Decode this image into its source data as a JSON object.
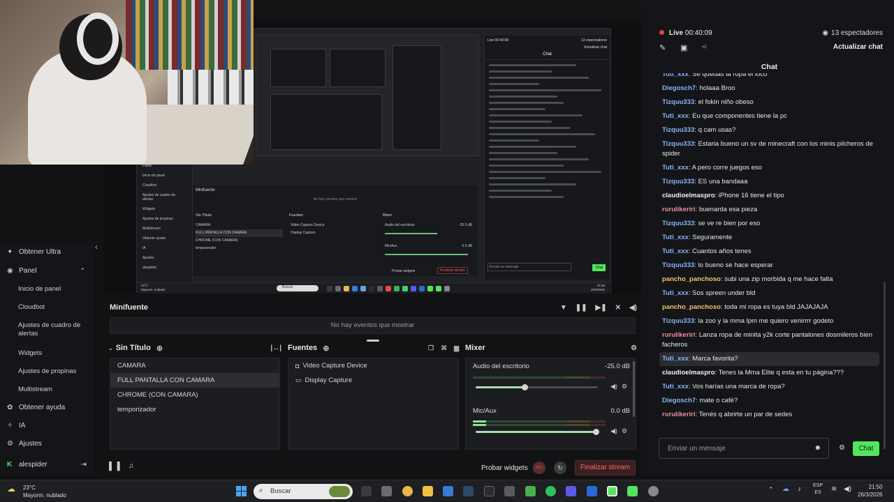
{
  "window": {
    "controls": [
      "—",
      "☐",
      "✕"
    ]
  },
  "camera": {},
  "preview": {
    "mini": {
      "sidebar": [
        "Panel",
        "Inicio de panel",
        "Cloudbot",
        "Ajustes de cuadro de alertas",
        "Widgets",
        "Ajustes de propinas",
        "Multistream",
        "Obtener ayuda",
        "IA",
        "Ajustes",
        "alespider"
      ],
      "minifeed": "Minifuente",
      "no_events": "No hay eventos que mostrar",
      "scenes_title": "Sin Título",
      "scenes": [
        "CAMARA",
        "FULL PANTALLA CON CAMARA",
        "CHROME (CON CAMARA)",
        "temporizador"
      ],
      "sources_title": "Fuentes",
      "sources": [
        "Video Capture Device",
        "Display Capture"
      ],
      "mixer_title": "Mixer",
      "mixer": [
        {
          "name": "Audio del escritorio",
          "db": "-25.0 dB"
        },
        {
          "name": "Mic/Aux",
          "db": "0.0 dB"
        }
      ],
      "test_widgets": "Probar widgets",
      "end_stream": "Finalizar stream",
      "chat_title": "Chat",
      "live": "Live 00:40:08",
      "viewers": "13 espectadores",
      "update_chat": "Actualizar chat",
      "chat_placeholder": "Enviar un mensaje",
      "chat_button": "Chat",
      "weather_temp": "23°C",
      "weather_desc": "Mayorm. nublado",
      "search": "Buscar",
      "time": "21:50",
      "date": "26/3/2026"
    }
  },
  "sidebar": {
    "items": [
      {
        "icon": "gem-icon",
        "label": "Obtener Ultra"
      },
      {
        "icon": "panel-icon",
        "label": "Panel"
      }
    ],
    "sub": [
      "Inicio de panel",
      "Cloudbot",
      "Ajustes de cuadro de alertas",
      "Widgets",
      "Ajustes de propinas",
      "Multistream"
    ],
    "bottom": [
      {
        "icon": "help-icon",
        "label": "Obtener ayuda"
      },
      {
        "icon": "ai-icon",
        "label": "IA"
      },
      {
        "icon": "gear-icon",
        "label": "Ajustes"
      }
    ],
    "user": "alespider"
  },
  "minifeed": {
    "title": "Minifuente",
    "empty": "No hay eventos que mostrar"
  },
  "scenes": {
    "title": "Sin Título",
    "items": [
      "CAMARA",
      "FULL PANTALLA CON CAMARA",
      "CHROME (CON CAMARA)",
      "temporizador"
    ],
    "selected": 1
  },
  "sources": {
    "title": "Fuentes",
    "items": [
      {
        "icon": "camera-icon",
        "label": "Video Capture Device"
      },
      {
        "icon": "monitor-icon",
        "label": "Display Capture"
      }
    ]
  },
  "mixer": {
    "title": "Mixer",
    "channels": [
      {
        "name": "Audio del escritorio",
        "db": "-25.0 dB",
        "volume": 0.4,
        "level": 0.0
      },
      {
        "name": "Mic/Aux",
        "db": "0.0 dB",
        "volume": 0.98,
        "level": 0.1
      }
    ]
  },
  "bottom_bar": {
    "test_widgets": "Probar widgets",
    "end_stream": "Finalizar stream",
    "rec": "REC"
  },
  "stream": {
    "live_label": "Live",
    "live_time": "00:40:09",
    "viewers": "13 espectadores",
    "update_chat": "Actualizar chat",
    "live_color": "#e0443c"
  },
  "chat": {
    "title": "Chat",
    "messages": [
      {
        "user": "Tuti_xxx",
        "text": "Se quedas la ropa el loco",
        "color": "#8ab4f8"
      },
      {
        "user": "Diegosch7",
        "text": "holaaa Broo",
        "color": "#8ab4f8"
      },
      {
        "user": "Tizquu333",
        "text": "el fokin niño obeso",
        "color": "#8ab4f8"
      },
      {
        "user": "Tuti_xxx",
        "text": "Eu que componentes tiene la pc",
        "color": "#8ab4f8"
      },
      {
        "user": "Tizquu333",
        "text": "q cam usas?",
        "color": "#8ab4f8"
      },
      {
        "user": "Tizquu333",
        "text": "Estaria bueno un sv de minecraft con los minis pilcheros de spider",
        "color": "#8ab4f8"
      },
      {
        "user": "Tuti_xxx",
        "text": "A pero corre juegos eso",
        "color": "#8ab4f8"
      },
      {
        "user": "Tizquu333",
        "text": "ES una bandaaa",
        "color": "#8ab4f8"
      },
      {
        "user": "claudioelmaspro",
        "text": "iPhone 16 tiene el tipo",
        "color": "#f2f2f2"
      },
      {
        "user": "rurulikeriri",
        "text": "buenarda esa pieza",
        "color": "#f08aa0"
      },
      {
        "user": "Tizquu333",
        "text": "se ve re bien por eso",
        "color": "#8ab4f8"
      },
      {
        "user": "Tuti_xxx",
        "text": "Seguramente",
        "color": "#8ab4f8"
      },
      {
        "user": "Tuti_xxx",
        "text": "Cuantos años tenes",
        "color": "#8ab4f8"
      },
      {
        "user": "Tizquu333",
        "text": "lo bueno se hace esperar",
        "color": "#8ab4f8"
      },
      {
        "user": "pancho_panchoso",
        "text": "subi una zip morbida q me hace falta",
        "color": "#f0c56a"
      },
      {
        "user": "Tuti_xxx",
        "text": "Sos spreen under bld",
        "color": "#8ab4f8"
      },
      {
        "user": "pancho_panchoso",
        "text": "toda mi ropa es tuya bld JAJAJAJA",
        "color": "#f0c56a"
      },
      {
        "user": "Tizquu333",
        "text": "la zoo y la mma lpm me quiero venirrrr godeto",
        "color": "#8ab4f8"
      },
      {
        "user": "rurulikeriri",
        "text": "Lanza ropa de minita y2k corte pantalones dosmileros bien facheros",
        "color": "#f08aa0"
      },
      {
        "user": "Tuti_xxx",
        "text": "Marca favorita?",
        "color": "#8ab4f8",
        "highlight": true
      },
      {
        "user": "claudioelmaspro",
        "text": "Tenes la Mma Elite q esta en tu página???",
        "color": "#f2f2f2"
      },
      {
        "user": "Tuti_xxx",
        "text": "Vos harías una marca de ropa?",
        "color": "#8ab4f8"
      },
      {
        "user": "Diegosch7",
        "text": "mate o café?",
        "color": "#8ab4f8"
      },
      {
        "user": "rurulikeriri",
        "text": "Tenés q abrirte un par de sedes",
        "color": "#f08aa0"
      }
    ],
    "input_placeholder": "Enviar un mensaje",
    "send_label": "Chat",
    "send_color": "#53e45e"
  },
  "taskbar": {
    "weather_temp": "23°C",
    "weather_desc": "Mayorm. nublado",
    "search_placeholder": "Buscar",
    "lang_top": "ESP",
    "lang_bottom": "ES",
    "time": "21:50",
    "date": "26/3/2026"
  }
}
